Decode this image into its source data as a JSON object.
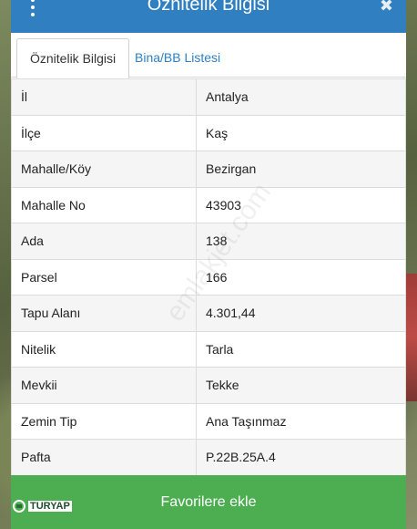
{
  "window": {
    "title": "Öznitelik Bilgisi",
    "close_symbol": "✖",
    "menu_icon": "vertical-dots-icon"
  },
  "tabs": [
    {
      "label": "Öznitelik Bilgisi",
      "active": true
    },
    {
      "label": "Bina/BB Listesi",
      "active": false
    }
  ],
  "rows": [
    {
      "key": "İl",
      "value": "Antalya"
    },
    {
      "key": "İlçe",
      "value": "Kaş"
    },
    {
      "key": "Mahalle/Köy",
      "value": "Bezirgan"
    },
    {
      "key": "Mahalle No",
      "value": "43903"
    },
    {
      "key": "Ada",
      "value": "138"
    },
    {
      "key": "Parsel",
      "value": "166"
    },
    {
      "key": "Tapu Alanı",
      "value": "4.301,44"
    },
    {
      "key": "Nitelik",
      "value": "Tarla"
    },
    {
      "key": "Mevkii",
      "value": "Tekke"
    },
    {
      "key": "Zemin Tip",
      "value": "Ana Taşınmaz"
    },
    {
      "key": "Pafta",
      "value": "P.22B.25A.4"
    }
  ],
  "actions": {
    "favorite_label": "Favorilere ekle"
  },
  "overlay": {
    "watermark": "emlakjet.com",
    "logo_text": "TURYAP"
  },
  "colors": {
    "header": "#2f7fc1",
    "favorite_bar": "#4cae50",
    "tab_link": "#2f7fc1"
  }
}
